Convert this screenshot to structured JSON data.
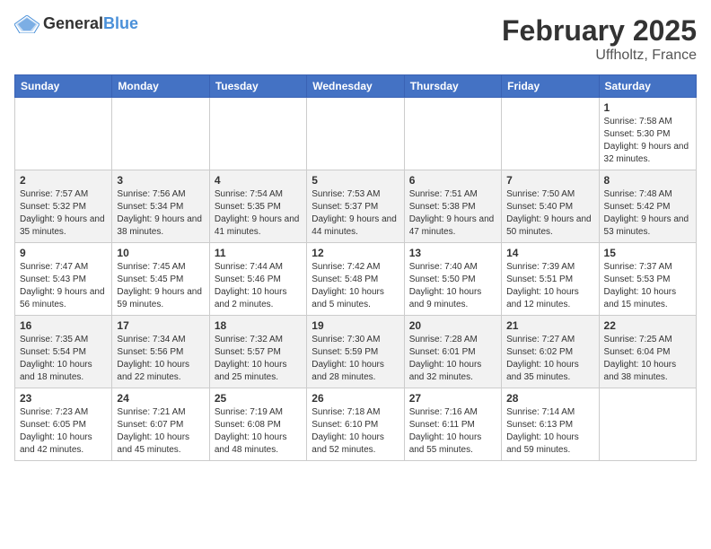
{
  "header": {
    "logo_general": "General",
    "logo_blue": "Blue",
    "month_year": "February 2025",
    "location": "Uffholtz, France"
  },
  "weekdays": [
    "Sunday",
    "Monday",
    "Tuesday",
    "Wednesday",
    "Thursday",
    "Friday",
    "Saturday"
  ],
  "weeks": [
    [
      {
        "day": "",
        "info": ""
      },
      {
        "day": "",
        "info": ""
      },
      {
        "day": "",
        "info": ""
      },
      {
        "day": "",
        "info": ""
      },
      {
        "day": "",
        "info": ""
      },
      {
        "day": "",
        "info": ""
      },
      {
        "day": "1",
        "info": "Sunrise: 7:58 AM\nSunset: 5:30 PM\nDaylight: 9 hours and 32 minutes."
      }
    ],
    [
      {
        "day": "2",
        "info": "Sunrise: 7:57 AM\nSunset: 5:32 PM\nDaylight: 9 hours and 35 minutes."
      },
      {
        "day": "3",
        "info": "Sunrise: 7:56 AM\nSunset: 5:34 PM\nDaylight: 9 hours and 38 minutes."
      },
      {
        "day": "4",
        "info": "Sunrise: 7:54 AM\nSunset: 5:35 PM\nDaylight: 9 hours and 41 minutes."
      },
      {
        "day": "5",
        "info": "Sunrise: 7:53 AM\nSunset: 5:37 PM\nDaylight: 9 hours and 44 minutes."
      },
      {
        "day": "6",
        "info": "Sunrise: 7:51 AM\nSunset: 5:38 PM\nDaylight: 9 hours and 47 minutes."
      },
      {
        "day": "7",
        "info": "Sunrise: 7:50 AM\nSunset: 5:40 PM\nDaylight: 9 hours and 50 minutes."
      },
      {
        "day": "8",
        "info": "Sunrise: 7:48 AM\nSunset: 5:42 PM\nDaylight: 9 hours and 53 minutes."
      }
    ],
    [
      {
        "day": "9",
        "info": "Sunrise: 7:47 AM\nSunset: 5:43 PM\nDaylight: 9 hours and 56 minutes."
      },
      {
        "day": "10",
        "info": "Sunrise: 7:45 AM\nSunset: 5:45 PM\nDaylight: 9 hours and 59 minutes."
      },
      {
        "day": "11",
        "info": "Sunrise: 7:44 AM\nSunset: 5:46 PM\nDaylight: 10 hours and 2 minutes."
      },
      {
        "day": "12",
        "info": "Sunrise: 7:42 AM\nSunset: 5:48 PM\nDaylight: 10 hours and 5 minutes."
      },
      {
        "day": "13",
        "info": "Sunrise: 7:40 AM\nSunset: 5:50 PM\nDaylight: 10 hours and 9 minutes."
      },
      {
        "day": "14",
        "info": "Sunrise: 7:39 AM\nSunset: 5:51 PM\nDaylight: 10 hours and 12 minutes."
      },
      {
        "day": "15",
        "info": "Sunrise: 7:37 AM\nSunset: 5:53 PM\nDaylight: 10 hours and 15 minutes."
      }
    ],
    [
      {
        "day": "16",
        "info": "Sunrise: 7:35 AM\nSunset: 5:54 PM\nDaylight: 10 hours and 18 minutes."
      },
      {
        "day": "17",
        "info": "Sunrise: 7:34 AM\nSunset: 5:56 PM\nDaylight: 10 hours and 22 minutes."
      },
      {
        "day": "18",
        "info": "Sunrise: 7:32 AM\nSunset: 5:57 PM\nDaylight: 10 hours and 25 minutes."
      },
      {
        "day": "19",
        "info": "Sunrise: 7:30 AM\nSunset: 5:59 PM\nDaylight: 10 hours and 28 minutes."
      },
      {
        "day": "20",
        "info": "Sunrise: 7:28 AM\nSunset: 6:01 PM\nDaylight: 10 hours and 32 minutes."
      },
      {
        "day": "21",
        "info": "Sunrise: 7:27 AM\nSunset: 6:02 PM\nDaylight: 10 hours and 35 minutes."
      },
      {
        "day": "22",
        "info": "Sunrise: 7:25 AM\nSunset: 6:04 PM\nDaylight: 10 hours and 38 minutes."
      }
    ],
    [
      {
        "day": "23",
        "info": "Sunrise: 7:23 AM\nSunset: 6:05 PM\nDaylight: 10 hours and 42 minutes."
      },
      {
        "day": "24",
        "info": "Sunrise: 7:21 AM\nSunset: 6:07 PM\nDaylight: 10 hours and 45 minutes."
      },
      {
        "day": "25",
        "info": "Sunrise: 7:19 AM\nSunset: 6:08 PM\nDaylight: 10 hours and 48 minutes."
      },
      {
        "day": "26",
        "info": "Sunrise: 7:18 AM\nSunset: 6:10 PM\nDaylight: 10 hours and 52 minutes."
      },
      {
        "day": "27",
        "info": "Sunrise: 7:16 AM\nSunset: 6:11 PM\nDaylight: 10 hours and 55 minutes."
      },
      {
        "day": "28",
        "info": "Sunrise: 7:14 AM\nSunset: 6:13 PM\nDaylight: 10 hours and 59 minutes."
      },
      {
        "day": "",
        "info": ""
      }
    ]
  ]
}
